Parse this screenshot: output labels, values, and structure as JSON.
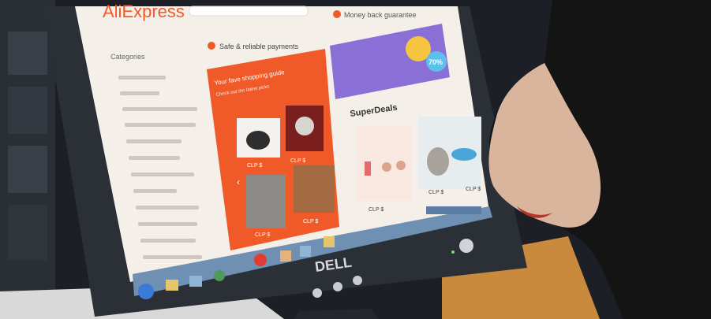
{
  "photo": {
    "monitor_brand": "DELL",
    "screen": {
      "logo": "AliExpress",
      "banner_left": "Safe & reliable payments",
      "banner_right": "Money back guarantee",
      "sidebar_title": "Categories",
      "promo_title": "Your fave shopping guide",
      "promo_subtitle": "Check out the latest picks",
      "promo_sale_badge": "70%",
      "superdeals_title": "SuperDeals",
      "price_tags": [
        "CLP $",
        "CLP $",
        "CLP $",
        "CLP $",
        "CLP $",
        "CLP $",
        "CLP $"
      ]
    },
    "colors": {
      "page_bg": "#f4efe9",
      "orange_accent": "#f05a28",
      "promo_purple": "#8a6fd6",
      "monitor_bezel": "#2b2f36",
      "hair": "#141414",
      "desk": "#c98a3e"
    }
  }
}
